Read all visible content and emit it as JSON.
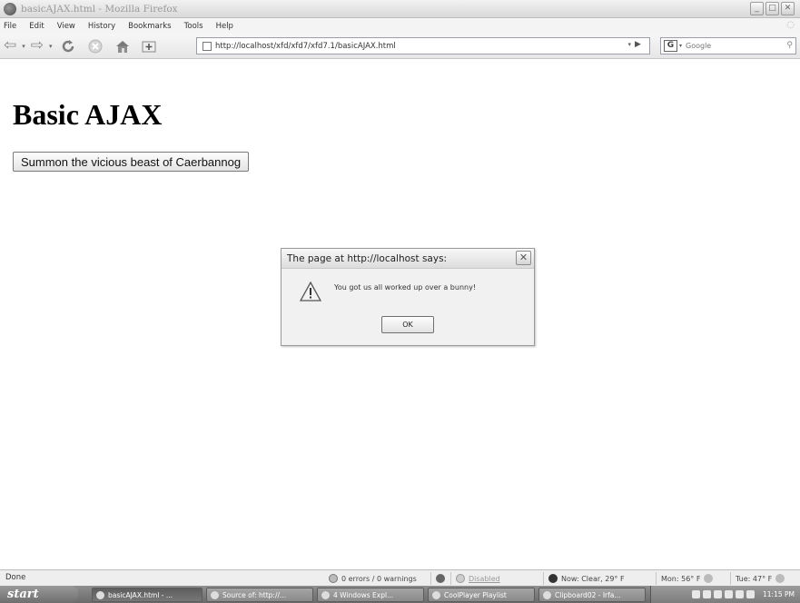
{
  "window": {
    "title": "basicAJAX.html - Mozilla Firefox",
    "controls": [
      "_",
      "□",
      "✕"
    ]
  },
  "menu": [
    "File",
    "Edit",
    "View",
    "History",
    "Bookmarks",
    "Tools",
    "Help"
  ],
  "address_bar": {
    "url": "http://localhost/xfd/xfd7/xfd7.1/basicAJAX.html"
  },
  "search_bar": {
    "engine": "G",
    "placeholder": "Google"
  },
  "page": {
    "heading": "Basic AJAX",
    "button_label": "Summon the vicious beast of Caerbannog"
  },
  "alert": {
    "title": "The page at http://localhost says:",
    "message": "You got us all worked up over a bunny!",
    "ok_label": "OK"
  },
  "status_bar": {
    "status": "Done",
    "errors": "0 errors / 0 warnings",
    "disabled": "Disabled",
    "weather_now": "Now: Clear, 29° F",
    "forecast_mon": "Mon: 56° F",
    "forecast_tue": "Tue: 47° F"
  },
  "taskbar": {
    "start": "start",
    "tasks": [
      "basicAJAX.html - ...",
      "Source of: http://...",
      "4 Windows Expl...",
      "CoolPlayer Playlist",
      "Clipboard02 - Irfa..."
    ],
    "clock": "11:15 PM"
  }
}
